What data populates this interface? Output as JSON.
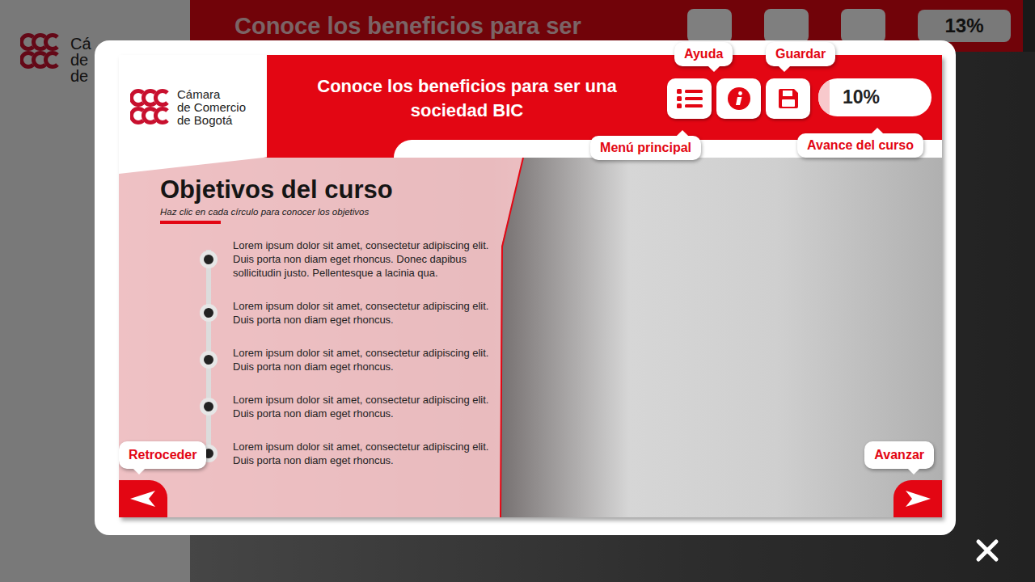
{
  "background": {
    "logo_lines": [
      "Cá",
      "de",
      "de"
    ],
    "title": "Conoce los beneficios para ser",
    "progress": "13%"
  },
  "logo": {
    "lines": [
      "Cámara",
      "de Comercio",
      "de Bogotá"
    ]
  },
  "header": {
    "title": "Conoce los beneficios para ser una sociedad BIC"
  },
  "toolbar": {
    "buttons": [
      {
        "kind": "menu",
        "tooltip": "Menú principal"
      },
      {
        "kind": "info",
        "tooltip": "Ayuda"
      },
      {
        "kind": "save",
        "tooltip": "Guardar"
      }
    ]
  },
  "progress": {
    "tooltip": "Avance del curso",
    "value": "10%",
    "level": 0.1
  },
  "content": {
    "title": "Objetivos del curso",
    "hint": "Haz clic en cada círculo para conocer los objetivos",
    "objectives": [
      {
        "text": "Lorem ipsum dolor sit amet, consectetur adipiscing elit. Duis porta non diam eget rhoncus. Donec dapibus sollicitudin justo. Pellentesque a lacinia qua."
      },
      {
        "text": "Lorem ipsum dolor sit amet, consectetur adipiscing elit. Duis porta non diam eget rhoncus."
      },
      {
        "text": "Lorem ipsum dolor sit amet, consectetur adipiscing elit. Duis porta non diam eget rhoncus."
      },
      {
        "text": "Lorem ipsum dolor sit amet, consectetur adipiscing elit. Duis porta non diam eget rhoncus."
      },
      {
        "text": "Lorem ipsum dolor sit amet, consectetur adipiscing elit. Duis porta non diam eget rhoncus."
      }
    ]
  },
  "nav": {
    "back": "Retroceder",
    "next": "Avanzar"
  }
}
